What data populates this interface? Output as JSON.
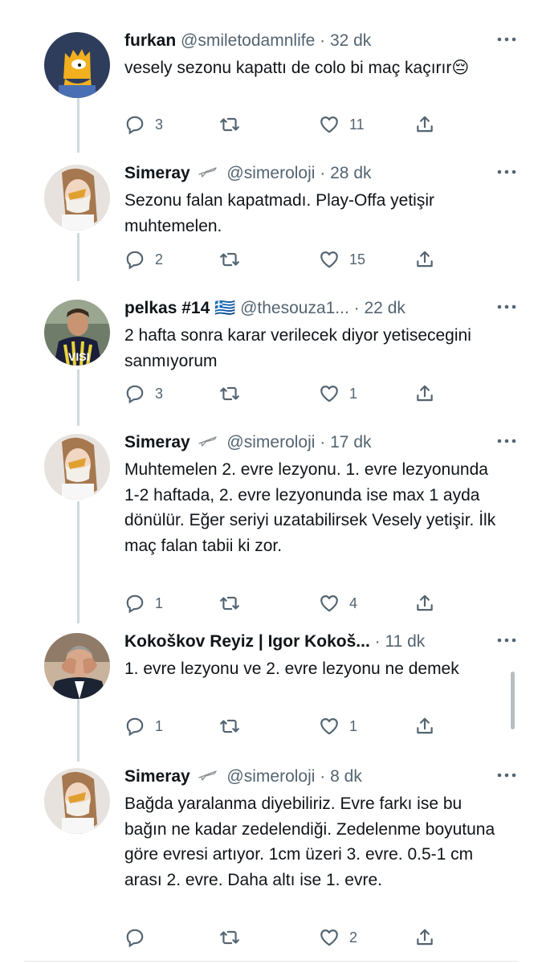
{
  "tweets": [
    {
      "name": "furkan",
      "handle": "@smiletodamnlife",
      "sep": "·",
      "time": "32 dk",
      "verified_icon": false,
      "text": "vesely sezonu kapattı de colo bi maç kaçırır😔",
      "replies": "3",
      "likes": "11",
      "avatar_icon": "bart-simpson-avatar"
    },
    {
      "name": "Simeray",
      "handle": "@simeroloji",
      "sep": "·",
      "time": "28 dk",
      "verified_icon": true,
      "text": "Sezonu falan kapatmadı. Play-Offa yetişir muhtemelen.",
      "replies": "2",
      "likes": "15",
      "avatar_icon": "mask-avatar"
    },
    {
      "name": "pelkas #14 🇬🇷",
      "handle": "@thesouza1...",
      "sep": "·",
      "time": "22 dk",
      "verified_icon": false,
      "text": "2 hafta sonra karar verilecek diyor yetisecegini sanmıyorum",
      "replies": "3",
      "likes": "1",
      "avatar_icon": "football-player-avatar"
    },
    {
      "name": "Simeray",
      "handle": "@simeroloji",
      "sep": "·",
      "time": "17 dk",
      "verified_icon": true,
      "text": "Muhtemelen 2. evre lezyonu. 1. evre lezyonunda 1-2 haftada, 2. evre lezyonunda ise max 1 ayda dönülür. Eğer seriyi uzatabilirsek Vesely yetişir. İlk maç falan tabii ki zor.",
      "replies": "1",
      "likes": "4",
      "avatar_icon": "mask-avatar"
    },
    {
      "name": "Kokoškov Reyiz | Igor Kokoš...",
      "handle": "",
      "sep": "·",
      "time": "11 dk",
      "verified_icon": false,
      "text": "1. evre lezyonu ve 2. evre lezyonu ne demek",
      "replies": "1",
      "likes": "1",
      "avatar_icon": "coach-avatar"
    },
    {
      "name": "Simeray",
      "handle": "@simeroloji",
      "sep": "·",
      "time": "8 dk",
      "verified_icon": true,
      "text": "Bağda yaralanma diyebiliriz. Evre farkı ise bu bağın ne kadar zedelendiği. Zedelenme boyutuna göre evresi artıyor. 1cm üzeri 3. evre. 0.5-1 cm arası 2. evre. Daha altı ise 1. evre.",
      "replies": "",
      "likes": "2",
      "avatar_icon": "mask-avatar"
    }
  ],
  "colors": {
    "text": "#0f1419",
    "secondary": "#536471",
    "thread_line": "#cfd9de"
  },
  "icons": {
    "reply": "reply-icon",
    "retweet": "retweet-icon",
    "like": "heart-icon",
    "share": "share-icon",
    "more": "more-options-icon"
  }
}
